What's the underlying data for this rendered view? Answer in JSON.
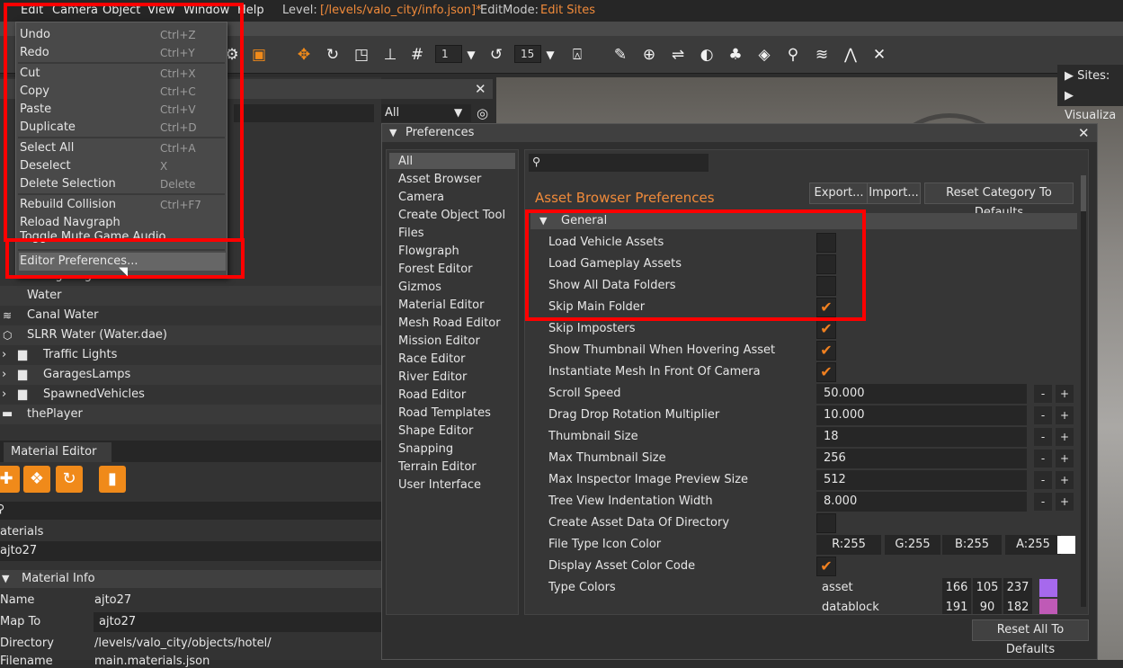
{
  "menubar": {
    "items": [
      "Edit",
      "Camera",
      "Object",
      "View",
      "Window",
      "Help"
    ],
    "level_label": "Level:",
    "level_path": "[/levels/valo_city/info.json]*",
    "editmode_label": "EditMode:",
    "editmode_value": "Edit Sites"
  },
  "edit_menu": {
    "items": [
      {
        "label": "Undo",
        "key": "Ctrl+Z"
      },
      {
        "label": "Redo",
        "key": "Ctrl+Y"
      },
      {
        "label": "Cut",
        "key": "Ctrl+X"
      },
      {
        "label": "Copy",
        "key": "Ctrl+C"
      },
      {
        "label": "Paste",
        "key": "Ctrl+V"
      },
      {
        "label": "Duplicate",
        "key": "Ctrl+D"
      },
      {
        "label": "Select All",
        "key": "Ctrl+A"
      },
      {
        "label": "Deselect",
        "key": "X"
      },
      {
        "label": "Delete Selection",
        "key": "Delete"
      },
      {
        "label": "Rebuild Collision",
        "key": "Ctrl+F7"
      },
      {
        "label": "Reload Navgraph",
        "key": ""
      },
      {
        "label": "Toggle Mute Game Audio",
        "key": ""
      },
      {
        "label": "Editor Preferences...",
        "key": ""
      }
    ]
  },
  "toolbar": {
    "num1": "1",
    "num2": "15"
  },
  "scene_tree": {
    "filter": "All",
    "rows": [
      "NightLights",
      "Water",
      "Canal Water",
      "SLRR Water (Water.dae)",
      "Traffic Lights",
      "GaragesLamps",
      "SpawnedVehicles",
      "thePlayer"
    ]
  },
  "material_editor": {
    "title": "Material Editor",
    "materials_label": "aterials",
    "material_name": "ajto27",
    "info_title": "Material Info",
    "name_label": "Name",
    "name_value": "ajto27",
    "mapto_label": "Map To",
    "mapto_value": "ajto27",
    "dir_label": "Directory",
    "dir_value": "/levels/valo_city/objects/hotel/",
    "file_label": "Filename",
    "file_value": "main.materials.json"
  },
  "viewport": {
    "sites_label": "Sites: Lo",
    "visualize_label": "Visualiza"
  },
  "preferences": {
    "title": "Preferences",
    "categories": [
      "All",
      "Asset Browser",
      "Camera",
      "Create Object Tool",
      "Files",
      "Flowgraph",
      "Forest Editor",
      "Gizmos",
      "Material Editor",
      "Mesh Road Editor",
      "Mission Editor",
      "Race Editor",
      "River Editor",
      "Road Editor",
      "Road Templates",
      "Shape Editor",
      "Snapping",
      "Terrain Editor",
      "User Interface"
    ],
    "heading": "Asset Browser Preferences",
    "export_label": "Export...",
    "import_label": "Import...",
    "reset_category_label": "Reset Category To Defaults",
    "section": "General",
    "checks": [
      {
        "label": "Load Vehicle Assets",
        "checked": false
      },
      {
        "label": "Load Gameplay Assets",
        "checked": false
      },
      {
        "label": "Show All Data Folders",
        "checked": false
      },
      {
        "label": "Skip Main Folder",
        "checked": true
      },
      {
        "label": "Skip Imposters",
        "checked": true
      },
      {
        "label": "Show Thumbnail When Hovering Asset",
        "checked": true
      },
      {
        "label": "Instantiate Mesh In Front Of Camera",
        "checked": true
      }
    ],
    "numbers": [
      {
        "label": "Scroll Speed",
        "value": "50.000"
      },
      {
        "label": "Drag Drop Rotation Multiplier",
        "value": "10.000"
      },
      {
        "label": "Thumbnail Size",
        "value": "18"
      },
      {
        "label": "Max Thumbnail Size",
        "value": "256"
      },
      {
        "label": "Max Inspector Image Preview Size",
        "value": "512"
      },
      {
        "label": "Tree View Indentation Width",
        "value": "8.000"
      }
    ],
    "create_asset_label": "Create Asset Data Of Directory",
    "file_icon_label": "File Type Icon Color",
    "color": {
      "r": "R:255",
      "g": "G:255",
      "b": "B:255",
      "a": "A:255"
    },
    "display_color_label": "Display Asset Color Code",
    "type_colors_label": "Type Colors",
    "type_colors": [
      {
        "name": "asset",
        "r": "166",
        "g": "105",
        "b": "237",
        "hex": "#a669ed"
      },
      {
        "name": "datablock",
        "r": "191",
        "g": "90",
        "b": "182",
        "hex": "#bf5ab6"
      }
    ],
    "reset_all_label": "Reset All To Defaults"
  }
}
